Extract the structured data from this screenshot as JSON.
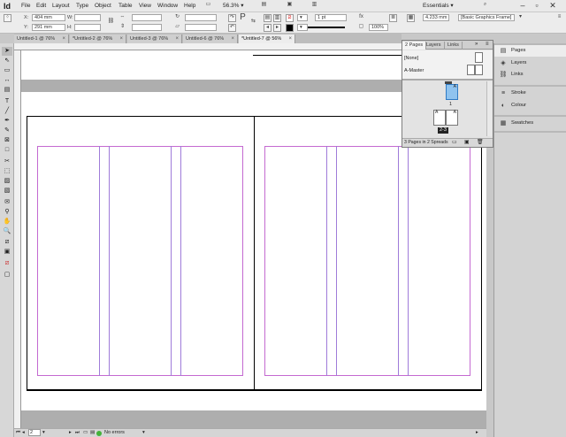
{
  "app": {
    "logo": "Id",
    "menus": [
      "File",
      "Edit",
      "Layout",
      "Type",
      "Object",
      "Table",
      "View",
      "Window",
      "Help"
    ],
    "zoom": "56.3%",
    "workspace": "Essentials"
  },
  "control": {
    "x_label": "X:",
    "x_value": "404 mm",
    "y_label": "Y:",
    "y_value": "291 mm",
    "w_label": "W:",
    "h_label": "H:",
    "stroke_weight": "1 pt",
    "opacity": "100%",
    "offset": "4.233 mm",
    "object_style": "[Basic Graphics Frame]"
  },
  "tabs": [
    {
      "label": "Untitled-1 @ 76%"
    },
    {
      "label": "*Untitled-2 @ 76%"
    },
    {
      "label": "Untitled-3 @ 76%"
    },
    {
      "label": "Untitled-6 @ 76%"
    },
    {
      "label": "*Untitled-7 @ 56%"
    }
  ],
  "pages_panel": {
    "tabs": [
      "2 Pages",
      "Layers",
      "Links"
    ],
    "masters": [
      {
        "label": "[None]"
      },
      {
        "label": "A-Master"
      }
    ],
    "page1_label": "1",
    "spread_label": "2-3",
    "status": "3 Pages in 2 Spreads"
  },
  "dock": {
    "items": [
      {
        "label": "Pages"
      },
      {
        "label": "Layers"
      },
      {
        "label": "Links"
      },
      {
        "label": "Stroke"
      },
      {
        "label": "Colour"
      },
      {
        "label": "Swatches"
      }
    ]
  },
  "status": {
    "page_value": "2",
    "errors": "No errors"
  },
  "colors": {
    "margin": "#c46ad1",
    "column": "#9f7bd9",
    "page_thumb": "#8fc3ef"
  }
}
